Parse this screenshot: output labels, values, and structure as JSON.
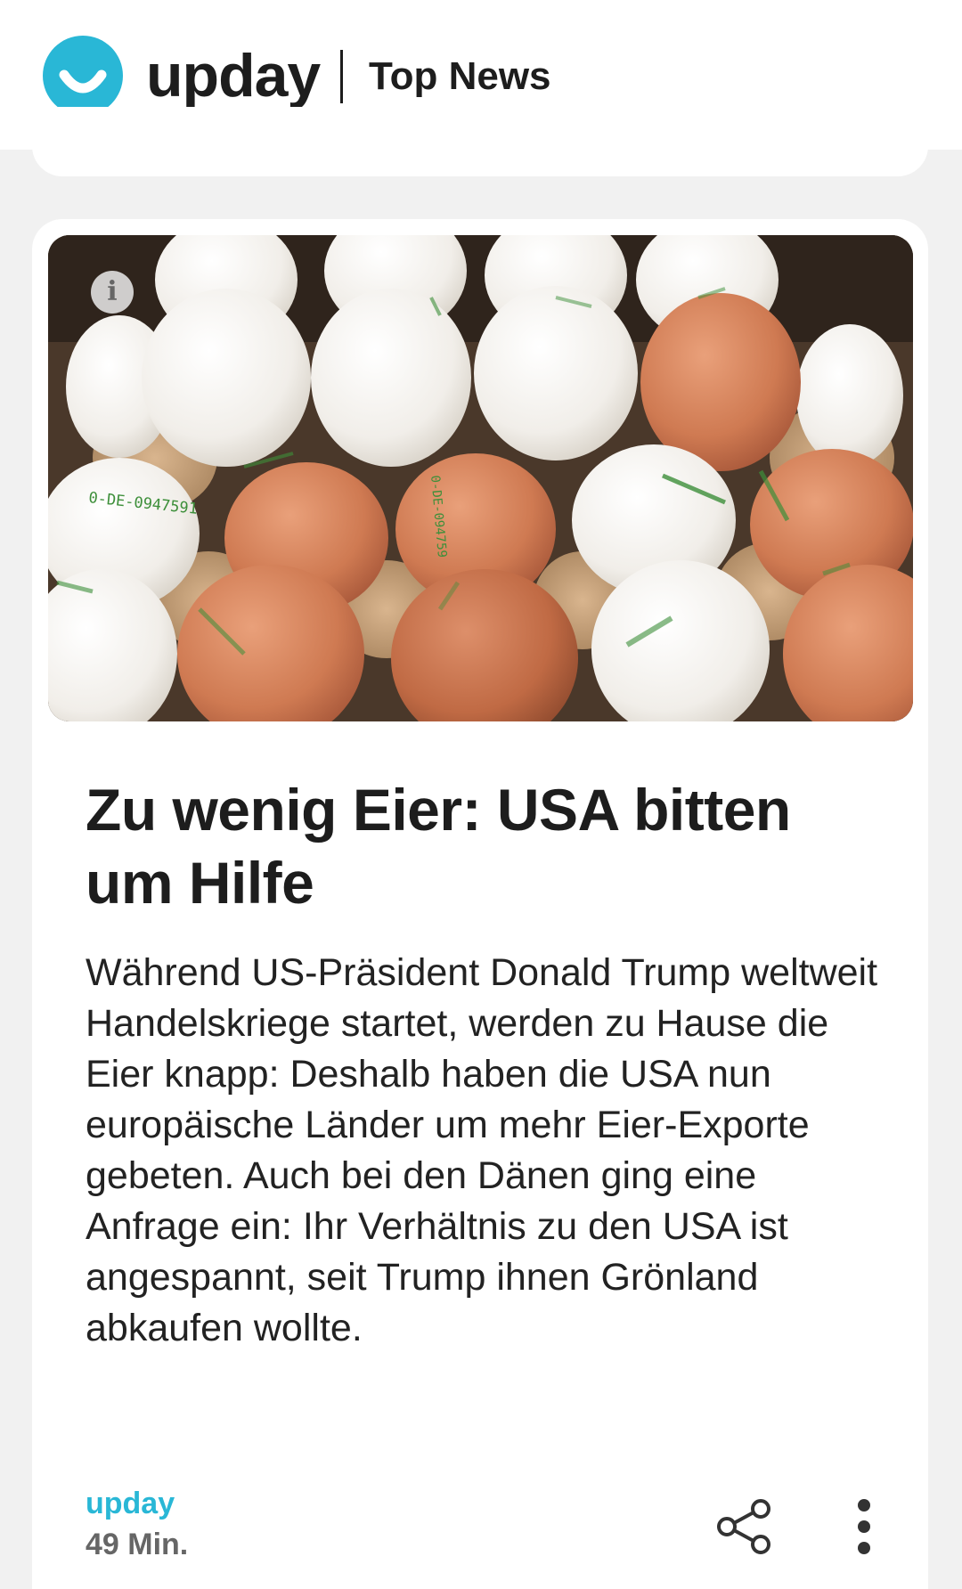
{
  "header": {
    "brand": "upday",
    "section": "Top News",
    "brand_color": "#29b7d6"
  },
  "article": {
    "image_alt_icon": "info-icon",
    "headline": "Zu wenig Eier: USA bitten um Hilfe",
    "teaser": "Während US-Präsident Donald Trump weltweit Handelskriege startet, werden zu Hause die Eier knapp: Deshalb haben die USA nun europäische Länder um mehr Eier-Exporte gebeten. Auch bei den Dänen ging eine Anfrage ein: Ihr Verhältnis zu den USA ist angespannt, seit Trump ihnen Grönland abkaufen wollte.",
    "source": "upday",
    "time": "49 Min.",
    "actions": {
      "share_icon": "share-icon",
      "more_icon": "more-vertical-icon"
    },
    "image_stamps": [
      "0-DE-0947591",
      "0-DE-094759"
    ]
  }
}
